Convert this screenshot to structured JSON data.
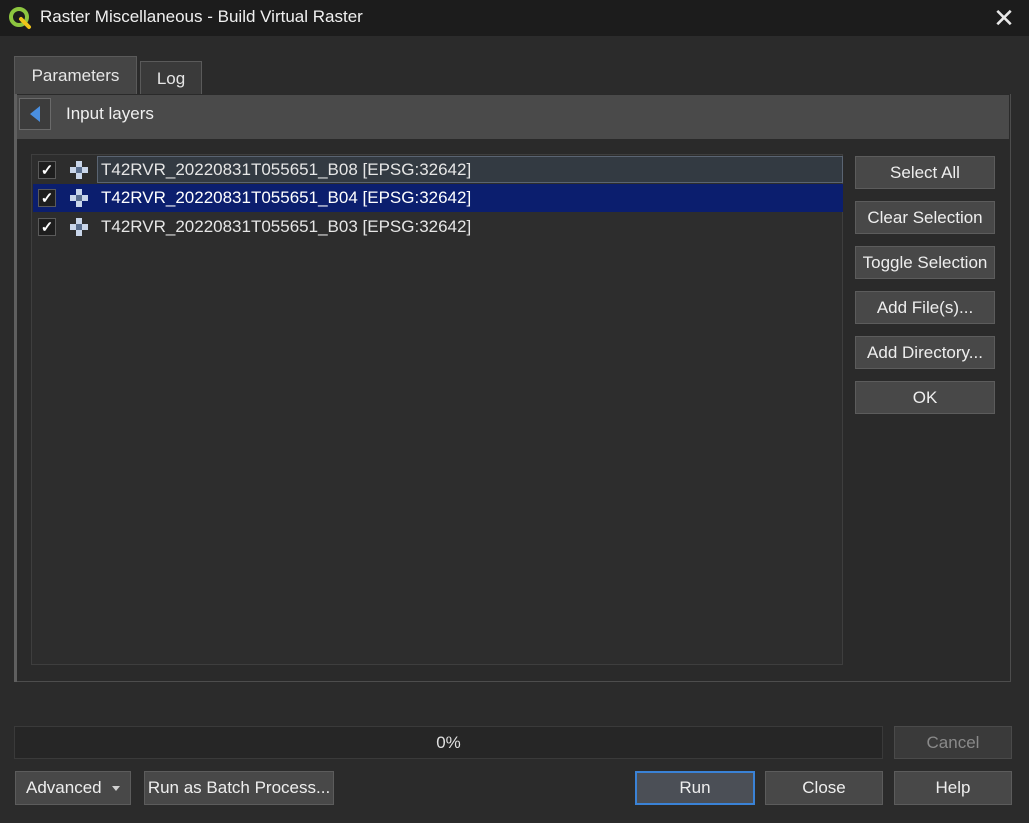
{
  "window": {
    "title": "Raster Miscellaneous - Build Virtual Raster",
    "close_glyph": "✕"
  },
  "tabs": [
    {
      "label": "Parameters",
      "active": true
    },
    {
      "label": "Log",
      "active": false
    }
  ],
  "panel": {
    "header_label": "Input layers",
    "back_icon": "triangle-left-icon"
  },
  "layers": [
    {
      "name": "T42RVR_20220831T055651_B08 [EPSG:32642]",
      "checked": true,
      "selected": false,
      "focused": true
    },
    {
      "name": "T42RVR_20220831T055651_B04 [EPSG:32642]",
      "checked": true,
      "selected": true,
      "focused": false
    },
    {
      "name": "T42RVR_20220831T055651_B03 [EPSG:32642]",
      "checked": true,
      "selected": false,
      "focused": false
    }
  ],
  "checkmark": "✓",
  "side_buttons": {
    "select_all": "Select All",
    "clear_selection": "Clear Selection",
    "toggle_selection": "Toggle Selection",
    "add_files": "Add File(s)...",
    "add_directory": "Add Directory...",
    "ok": "OK"
  },
  "progress": {
    "text": "0%",
    "value": 0
  },
  "buttons": {
    "cancel": "Cancel",
    "advanced": "Advanced",
    "batch": "Run as Batch Process...",
    "run": "Run",
    "close": "Close",
    "help": "Help"
  },
  "colors": {
    "selection": "#0b1e6e",
    "accent": "#3a82d6",
    "qgis_green": "#8dc63f",
    "qgis_yellow": "#f0c419"
  }
}
